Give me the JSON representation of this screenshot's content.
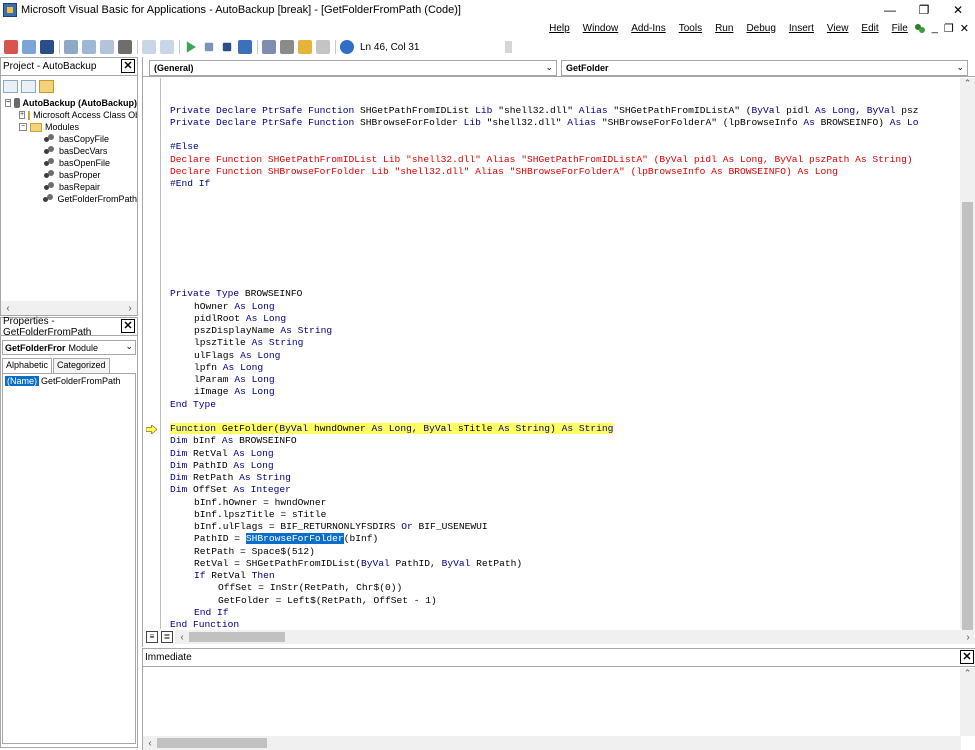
{
  "window": {
    "title": "Microsoft Visual Basic for Applications - AutoBackup [break] - [GetFolderFromPath (Code)]",
    "minimize": "—",
    "restore": "❐",
    "close": "✕"
  },
  "menu": {
    "items": [
      "Help",
      "Window",
      "Add-Ins",
      "Tools",
      "Run",
      "Debug",
      "Insert",
      "View",
      "Edit",
      "File"
    ],
    "mdi_minimize": "_",
    "mdi_restore": "❐",
    "mdi_close": "✕"
  },
  "toolbar": {
    "status": "Ln 46, Col 31"
  },
  "project_pane": {
    "title": "Project - AutoBackup",
    "close": "✕",
    "tree": [
      {
        "label": "AutoBackup (AutoBackup)",
        "level": 0,
        "icon": "project-icon",
        "expand": "−",
        "bold": true
      },
      {
        "label": "Microsoft Access Class Objects",
        "level": 1,
        "icon": "folder-icon",
        "expand": "+"
      },
      {
        "label": "Modules",
        "level": 1,
        "icon": "folder-icon",
        "expand": "−"
      },
      {
        "label": "basCopyFile",
        "level": 2,
        "icon": "module-icon"
      },
      {
        "label": "basDecVars",
        "level": 2,
        "icon": "module-icon"
      },
      {
        "label": "basOpenFile",
        "level": 2,
        "icon": "module-icon"
      },
      {
        "label": "basProper",
        "level": 2,
        "icon": "module-icon"
      },
      {
        "label": "basRepair",
        "level": 2,
        "icon": "module-icon"
      },
      {
        "label": "GetFolderFromPath",
        "level": 2,
        "icon": "module-icon"
      }
    ]
  },
  "properties_pane": {
    "title": "Properties - GetFolderFromPath",
    "close": "✕",
    "object_name": "GetFolderFror",
    "object_type": "Module",
    "tabs": [
      "Alphabetic",
      "Categorized"
    ],
    "rows": [
      {
        "name": "(Name)",
        "value": "GetFolderFromPath"
      }
    ]
  },
  "code_window": {
    "object_combo": "(General)",
    "proc_combo": "GetFolder",
    "lines": [
      {
        "row": 2,
        "indent": 0,
        "segs": [
          [
            "kw",
            "Private Declare PtrSafe Function "
          ],
          [
            "tx",
            "SHGetPathFromIDList "
          ],
          [
            "kw",
            "Lib "
          ],
          [
            "tx",
            "\"shell32.dll\" "
          ],
          [
            "kw",
            "Alias "
          ],
          [
            "tx",
            "\"SHGetPathFromIDListA\" ("
          ],
          [
            "kw",
            "ByVal "
          ],
          [
            "tx",
            "pidl "
          ],
          [
            "kw",
            "As Long"
          ],
          [
            "tx",
            ", "
          ],
          [
            "kw",
            "ByVal "
          ],
          [
            "tx",
            "psz"
          ]
        ]
      },
      {
        "row": 3,
        "indent": 0,
        "segs": [
          [
            "kw",
            "Private Declare PtrSafe Function "
          ],
          [
            "tx",
            "SHBrowseForFolder "
          ],
          [
            "kw",
            "Lib "
          ],
          [
            "tx",
            "\"shell32.dll\" "
          ],
          [
            "kw",
            "Alias "
          ],
          [
            "tx",
            "\"SHBrowseForFolderA\" (lpBrowseInfo "
          ],
          [
            "kw",
            "As "
          ],
          [
            "tx",
            "BROWSEINFO) "
          ],
          [
            "kw",
            "As Lo"
          ]
        ]
      },
      {
        "row": 5,
        "indent": 0,
        "segs": [
          [
            "kw",
            "#Else"
          ]
        ]
      },
      {
        "row": 6,
        "indent": 0,
        "segs": [
          [
            "red",
            "Declare Function SHGetPathFromIDList Lib \"shell32.dll\" Alias \"SHGetPathFromIDListA\" (ByVal pidl As Long, ByVal pszPath As String)"
          ]
        ]
      },
      {
        "row": 7,
        "indent": 0,
        "segs": [
          [
            "red",
            "Declare Function SHBrowseForFolder Lib \"shell32.dll\" Alias \"SHBrowseForFolderA\" (lpBrowseInfo As BROWSEINFO) As Long"
          ]
        ]
      },
      {
        "row": 8,
        "indent": 0,
        "segs": [
          [
            "kw",
            "#End If"
          ]
        ]
      },
      {
        "row": 17,
        "indent": 0,
        "segs": [
          [
            "kw",
            "Private Type "
          ],
          [
            "tx",
            "BROWSEINFO"
          ]
        ]
      },
      {
        "row": 18,
        "indent": 1,
        "segs": [
          [
            "tx",
            "hOwner "
          ],
          [
            "kw",
            "As Long"
          ]
        ]
      },
      {
        "row": 19,
        "indent": 1,
        "segs": [
          [
            "tx",
            "pidlRoot "
          ],
          [
            "kw",
            "As Long"
          ]
        ]
      },
      {
        "row": 20,
        "indent": 1,
        "segs": [
          [
            "tx",
            "pszDisplayName "
          ],
          [
            "kw",
            "As String"
          ]
        ]
      },
      {
        "row": 21,
        "indent": 1,
        "segs": [
          [
            "tx",
            "lpszTitle "
          ],
          [
            "kw",
            "As String"
          ]
        ]
      },
      {
        "row": 22,
        "indent": 1,
        "segs": [
          [
            "tx",
            "ulFlags "
          ],
          [
            "kw",
            "As Long"
          ]
        ]
      },
      {
        "row": 23,
        "indent": 1,
        "segs": [
          [
            "tx",
            "lpfn "
          ],
          [
            "kw",
            "As Long"
          ]
        ]
      },
      {
        "row": 24,
        "indent": 1,
        "segs": [
          [
            "tx",
            "lParam "
          ],
          [
            "kw",
            "As Long"
          ]
        ]
      },
      {
        "row": 25,
        "indent": 1,
        "segs": [
          [
            "tx",
            "iImage "
          ],
          [
            "kw",
            "As Long"
          ]
        ]
      },
      {
        "row": 26,
        "indent": 0,
        "segs": [
          [
            "kw",
            "End Type"
          ]
        ]
      },
      {
        "row": 28,
        "indent": 0,
        "exec": true,
        "segs": [
          [
            "kw hl-yellow",
            "Function "
          ],
          [
            "tx hl-yellow",
            "GetFolder("
          ],
          [
            "kw hl-yellow",
            "ByVal "
          ],
          [
            "tx hl-yellow",
            "hwndOwner "
          ],
          [
            "kw hl-yellow",
            "As Long"
          ],
          [
            "tx hl-yellow",
            ", "
          ],
          [
            "kw hl-yellow",
            "ByVal "
          ],
          [
            "tx hl-yellow",
            "sTitle "
          ],
          [
            "kw hl-yellow",
            "As String"
          ],
          [
            "tx hl-yellow",
            ") "
          ],
          [
            "kw hl-yellow",
            "As String"
          ]
        ]
      },
      {
        "row": 29,
        "indent": 0,
        "segs": [
          [
            "kw",
            "Dim "
          ],
          [
            "tx",
            "bInf "
          ],
          [
            "kw",
            "As "
          ],
          [
            "tx",
            "BROWSEINFO"
          ]
        ]
      },
      {
        "row": 30,
        "indent": 0,
        "segs": [
          [
            "kw",
            "Dim "
          ],
          [
            "tx",
            "RetVal "
          ],
          [
            "kw",
            "As Long"
          ]
        ]
      },
      {
        "row": 31,
        "indent": 0,
        "segs": [
          [
            "kw",
            "Dim "
          ],
          [
            "tx",
            "PathID "
          ],
          [
            "kw",
            "As Long"
          ]
        ]
      },
      {
        "row": 32,
        "indent": 0,
        "segs": [
          [
            "kw",
            "Dim "
          ],
          [
            "tx",
            "RetPath "
          ],
          [
            "kw",
            "As String"
          ]
        ]
      },
      {
        "row": 33,
        "indent": 0,
        "segs": [
          [
            "kw",
            "Dim "
          ],
          [
            "tx",
            "OffSet "
          ],
          [
            "kw",
            "As Integer"
          ]
        ]
      },
      {
        "row": 34,
        "indent": 1,
        "segs": [
          [
            "tx",
            "bInf.hOwner = hwndOwner"
          ]
        ]
      },
      {
        "row": 35,
        "indent": 1,
        "segs": [
          [
            "tx",
            "bInf.lpszTitle = sTitle"
          ]
        ]
      },
      {
        "row": 36,
        "indent": 1,
        "segs": [
          [
            "tx",
            "bInf.ulFlags = BIF_RETURNONLYFSDIRS "
          ],
          [
            "kw",
            "Or "
          ],
          [
            "tx",
            "BIF_USENEWUI"
          ]
        ]
      },
      {
        "row": 37,
        "indent": 1,
        "segs": [
          [
            "tx",
            "PathID = "
          ],
          [
            "sel",
            "SHBrowseForFolder"
          ],
          [
            "tx",
            "(bInf)"
          ]
        ]
      },
      {
        "row": 38,
        "indent": 1,
        "segs": [
          [
            "tx",
            "RetPath = Space$(512)"
          ]
        ]
      },
      {
        "row": 39,
        "indent": 1,
        "segs": [
          [
            "tx",
            "RetVal = SHGetPathFromIDList("
          ],
          [
            "kw",
            "ByVal "
          ],
          [
            "tx",
            "PathID, "
          ],
          [
            "kw",
            "ByVal "
          ],
          [
            "tx",
            "RetPath)"
          ]
        ]
      },
      {
        "row": 40,
        "indent": 1,
        "segs": [
          [
            "kw",
            "If "
          ],
          [
            "tx",
            "RetVal "
          ],
          [
            "kw",
            "Then"
          ]
        ]
      },
      {
        "row": 41,
        "indent": 2,
        "segs": [
          [
            "tx",
            "OffSet = InStr(RetPath, Chr$(0))"
          ]
        ]
      },
      {
        "row": 42,
        "indent": 2,
        "segs": [
          [
            "tx",
            "GetFolder = Left$(RetPath, OffSet - 1)"
          ]
        ]
      },
      {
        "row": 43,
        "indent": 1,
        "segs": [
          [
            "kw",
            "End If"
          ]
        ]
      },
      {
        "row": 44,
        "indent": 0,
        "segs": [
          [
            "kw",
            "End Function"
          ]
        ]
      }
    ]
  },
  "immediate_pane": {
    "title": "Immediate",
    "close": "✕"
  },
  "colors": {
    "keyword": "#00008b",
    "disabled_code": "#e00000",
    "exec_highlight": "#ffff60",
    "selection": "#0b6fc9"
  }
}
